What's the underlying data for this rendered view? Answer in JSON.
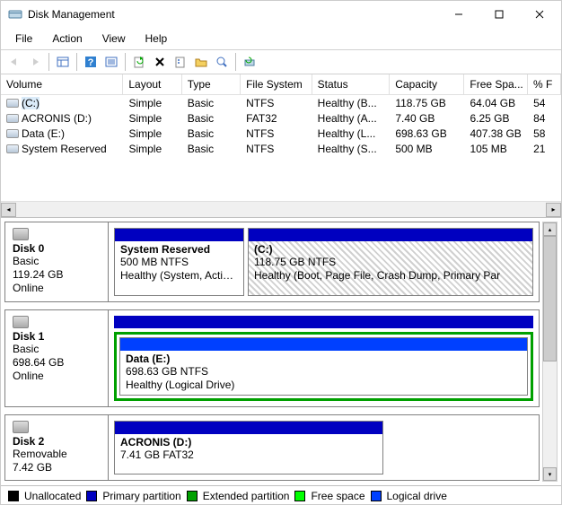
{
  "window": {
    "title": "Disk Management"
  },
  "menu": {
    "file": "File",
    "action": "Action",
    "view": "View",
    "help": "Help"
  },
  "columns": {
    "volume": "Volume",
    "layout": "Layout",
    "type": "Type",
    "fs": "File System",
    "status": "Status",
    "capacity": "Capacity",
    "free": "Free Spa...",
    "pct": "% F"
  },
  "volumes": [
    {
      "name": "(C:)",
      "layout": "Simple",
      "type": "Basic",
      "fs": "NTFS",
      "status": "Healthy (B...",
      "capacity": "118.75 GB",
      "free": "64.04 GB",
      "pct": "54"
    },
    {
      "name": "ACRONIS (D:)",
      "layout": "Simple",
      "type": "Basic",
      "fs": "FAT32",
      "status": "Healthy (A...",
      "capacity": "7.40 GB",
      "free": "6.25 GB",
      "pct": "84"
    },
    {
      "name": "Data (E:)",
      "layout": "Simple",
      "type": "Basic",
      "fs": "NTFS",
      "status": "Healthy (L...",
      "capacity": "698.63 GB",
      "free": "407.38 GB",
      "pct": "58"
    },
    {
      "name": "System Reserved",
      "layout": "Simple",
      "type": "Basic",
      "fs": "NTFS",
      "status": "Healthy (S...",
      "capacity": "500 MB",
      "free": "105 MB",
      "pct": "21"
    }
  ],
  "disk0": {
    "name": "Disk 0",
    "type": "Basic",
    "size": "119.24 GB",
    "state": "Online",
    "p1": {
      "title": "System Reserved",
      "line2": "500 MB NTFS",
      "line3": "Healthy (System, Active, I"
    },
    "p2": {
      "title": "(C:)",
      "line2": "118.75 GB NTFS",
      "line3": "Healthy (Boot, Page File, Crash Dump, Primary Par"
    }
  },
  "disk1": {
    "name": "Disk 1",
    "type": "Basic",
    "size": "698.64 GB",
    "state": "Online",
    "p1": {
      "title": "Data  (E:)",
      "line2": "698.63 GB NTFS",
      "line3": "Healthy (Logical Drive)"
    }
  },
  "disk2": {
    "name": "Disk 2",
    "type": "Removable",
    "size": "7.42 GB",
    "p1": {
      "title": "ACRONIS  (D:)",
      "line2": "7.41 GB FAT32"
    }
  },
  "legend": {
    "unalloc": "Unallocated",
    "primary": "Primary partition",
    "ext": "Extended partition",
    "free": "Free space",
    "logical": "Logical drive"
  }
}
